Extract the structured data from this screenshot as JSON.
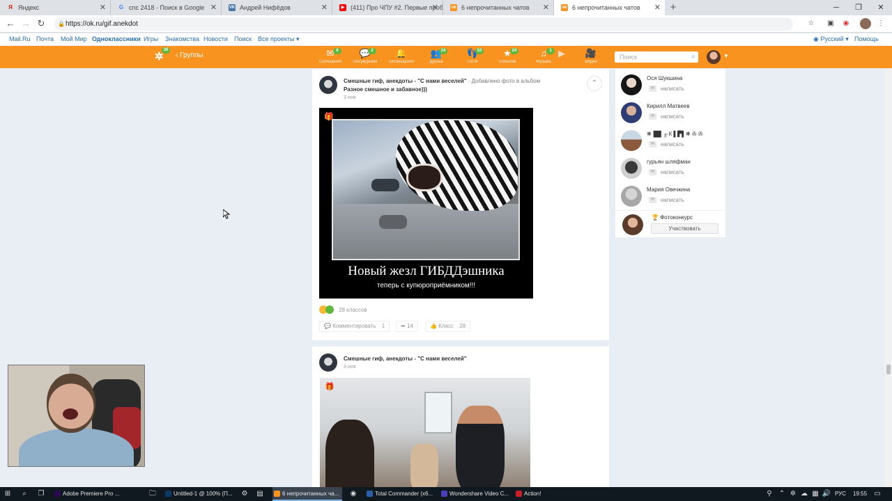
{
  "browser": {
    "tabs": [
      {
        "title": "Яндекс",
        "fav": "Я",
        "color": "#ffffff",
        "fg": "#e61400"
      },
      {
        "title": "cnc 2418 - Поиск в Google",
        "fav": "G",
        "color": "#ffffff",
        "fg": "#4285f4"
      },
      {
        "title": "Андрей Нифёдов",
        "fav": "VK",
        "color": "#4a76a8",
        "fg": "#ffffff"
      },
      {
        "title": "(411) Про ЧПУ #2. Первые проб",
        "fav": "▶",
        "color": "#ff0000",
        "fg": "#ffffff"
      },
      {
        "title": "6 непрочитанных чатов",
        "fav": "ok",
        "color": "#f7931e",
        "fg": "#ffffff"
      },
      {
        "title": "6 непрочитанных чатов",
        "fav": "ok",
        "color": "#f7931e",
        "fg": "#ffffff"
      }
    ],
    "url": "https://ok.ru/gif.anekdot"
  },
  "portal": {
    "links": [
      "Mail.Ru",
      "Почта",
      "Мой Мир",
      "Одноклассники",
      "Игры",
      "Знакомства",
      "Новости",
      "Поиск",
      "Все проекты ▾"
    ],
    "lang": "Русский ▾",
    "help": "Помощь"
  },
  "okbar": {
    "logo_badge": "36",
    "back_label": "Группы",
    "tools": [
      {
        "icon": "✉",
        "label": "Сообщения",
        "badge": "6"
      },
      {
        "icon": "💬",
        "label": "Обсуждения",
        "badge": "2"
      },
      {
        "icon": "🔔",
        "label": "Оповещения",
        "badge": ""
      },
      {
        "icon": "👥",
        "label": "Друзья",
        "badge": "24"
      },
      {
        "icon": "👣",
        "label": "Гости",
        "badge": "53"
      },
      {
        "icon": "★",
        "label": "События",
        "badge": "24"
      },
      {
        "icon": "♫",
        "label": "Музыка",
        "badge": "1"
      },
      {
        "icon": "🎥",
        "label": "Видео",
        "badge": ""
      }
    ],
    "search_placeholder": "Поиск"
  },
  "posts": [
    {
      "author": "Смешные гиф, анекдоты - \"С нами веселей\"",
      "meta": "· Добавлено фото в альбом",
      "album": "Разное смешное и забавное)))",
      "date": "3 ноя",
      "caption_big": "Новый жезл ГИБДДэшника",
      "caption_small": "теперь с купюроприёмником!!!",
      "reactions": "28 классов",
      "comment_label": "Комментировать",
      "comment_count": "1",
      "share_count": "14",
      "like_label": "Класс",
      "like_count": "28"
    },
    {
      "author": "Смешные гиф, анекдоты - \"С нами веселей\"",
      "date": "3 ноя"
    }
  ],
  "friends": [
    {
      "name": "Ося Шукшина",
      "action": "написать"
    },
    {
      "name": "Кирилл Матвеев",
      "action": "написать"
    },
    {
      "name": "❋▐█▌╓ К ▌▛▌❋ ✇ ✇",
      "action": "написать"
    },
    {
      "name": "гурьян шляфман",
      "action": "написать"
    },
    {
      "name": "Мария Овечкина",
      "action": "написать"
    }
  ],
  "contest": {
    "label": "Фотоконкурс",
    "button": "Участвовать"
  },
  "taskbar": {
    "apps": [
      {
        "label": "Adobe Premiere Pro ...",
        "color": "#2a0b52"
      },
      {
        "label": "Untitled-1 @ 100% (П...",
        "color": "#0b3a63"
      },
      {
        "label": "6 непрочитанных ча...",
        "color": "#f7931e"
      },
      {
        "label": "Total Commander (x6...",
        "color": "#2b5fa8"
      },
      {
        "label": "Wondershare Video C...",
        "color": "#4b3cb8"
      },
      {
        "label": "Action!",
        "color": "#c8202a"
      }
    ],
    "lang": "РУС",
    "time": "19:55"
  }
}
